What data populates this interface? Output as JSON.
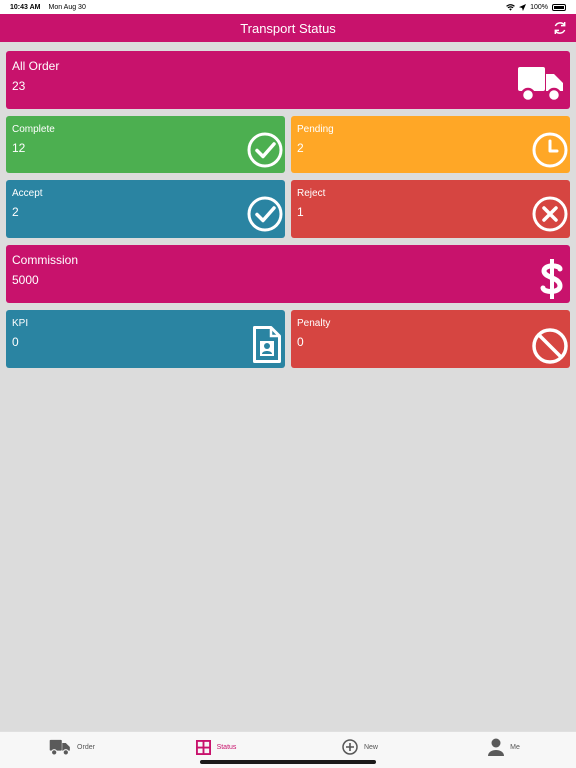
{
  "status_bar": {
    "time": "10:43 AM",
    "date": "Mon Aug 30",
    "battery": "100%"
  },
  "header": {
    "title": "Transport Status",
    "refresh_icon": "refresh-icon"
  },
  "cards": {
    "all_order": {
      "label": "All Order",
      "value": "23",
      "icon": "truck-icon"
    },
    "complete": {
      "label": "Complete",
      "value": "12",
      "icon": "check-circle-icon"
    },
    "pending": {
      "label": "Pending",
      "value": "2",
      "icon": "clock-icon"
    },
    "accept": {
      "label": "Accept",
      "value": "2",
      "icon": "check-circle-icon"
    },
    "reject": {
      "label": "Reject",
      "value": "1",
      "icon": "x-circle-icon"
    },
    "commission": {
      "label": "Commission",
      "value": "5000",
      "icon": "dollar-icon"
    },
    "kpi": {
      "label": "KPI",
      "value": "0",
      "icon": "document-user-icon"
    },
    "penalty": {
      "label": "Penalty",
      "value": "0",
      "icon": "ban-icon"
    }
  },
  "tabs": [
    {
      "label": "Order",
      "icon": "truck-icon"
    },
    {
      "label": "Status",
      "icon": "grid-icon"
    },
    {
      "label": "New",
      "icon": "plus-circle-icon"
    },
    {
      "label": "Me",
      "icon": "user-icon"
    }
  ],
  "colors": {
    "primary": "#c8126c",
    "green": "#4caf50",
    "orange": "#ffa726",
    "blue": "#2a84a2",
    "red": "#d64541",
    "background": "#dcdcdc"
  },
  "active_tab": "Status"
}
